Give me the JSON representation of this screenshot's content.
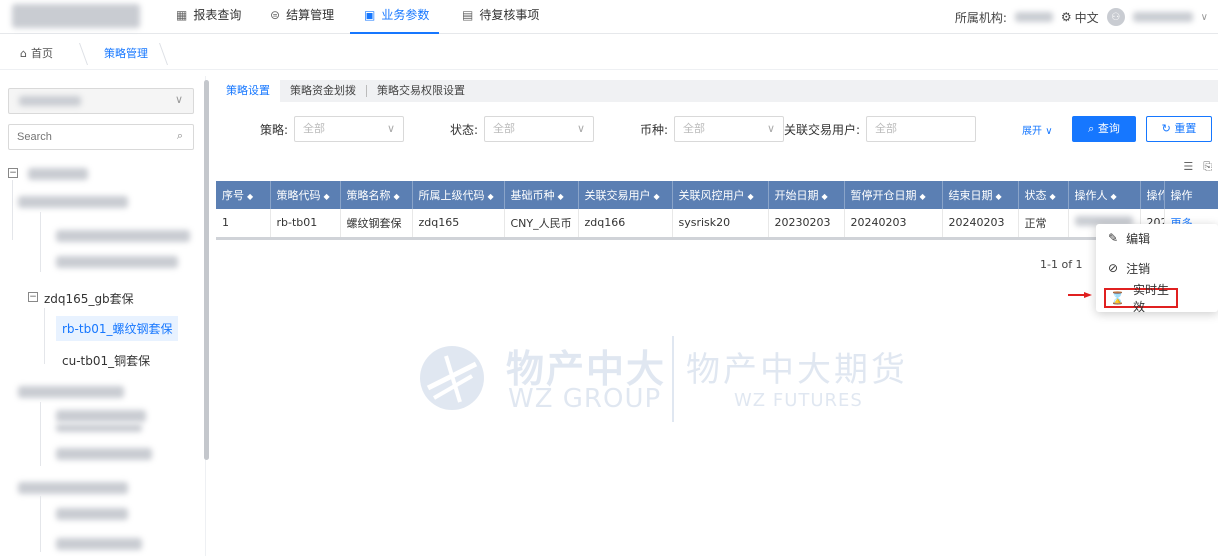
{
  "nav": {
    "items": [
      {
        "icon": "table-icon",
        "glyph": "▦",
        "label": "报表查询"
      },
      {
        "icon": "settlement-icon",
        "glyph": "⊜",
        "label": "结算管理"
      },
      {
        "icon": "params-icon",
        "glyph": "▣",
        "label": "业务参数"
      },
      {
        "icon": "review-icon",
        "glyph": "▤",
        "label": "待复核事项"
      }
    ],
    "org_label": "所属机构:",
    "lang": "中文",
    "lang_icon": "⚙"
  },
  "breadcrumb": {
    "home": "首页",
    "current": "策略管理"
  },
  "sidebar": {
    "search_placeholder": "Search",
    "group_label": "zdq165_gb套保",
    "selected_node": "rb-tb01_螺纹钢套保",
    "other_node": "cu-tb01_铜套保"
  },
  "tabs": [
    "策略设置",
    "策略资金划拨",
    "策略交易权限设置"
  ],
  "filters": {
    "strategy_label": "策略:",
    "strategy_value": "全部",
    "status_label": "状态:",
    "status_value": "全部",
    "currency_label": "币种:",
    "currency_value": "全部",
    "user_label": "关联交易用户:",
    "user_placeholder": "全部",
    "expand": "展开",
    "query": "查询",
    "reset": "重置"
  },
  "table": {
    "headers": [
      "序号",
      "策略代码",
      "策略名称",
      "所属上级代码",
      "基础币种",
      "关联交易用户",
      "关联风控用户",
      "开始日期",
      "暂停开仓日期",
      "结束日期",
      "状态",
      "操作人",
      "操作",
      "操作"
    ],
    "rows": [
      [
        "1",
        "rb-tb01",
        "螺纹钢套保",
        "zdq165",
        "CNY_人民币",
        "zdq166",
        "sysrisk20",
        "20230203",
        "20240203",
        "20240203",
        "正常",
        "",
        "202",
        "更多"
      ]
    ]
  },
  "pagination": "1-1 of 1",
  "watermark": {
    "cn": "物产中大",
    "en": "WZ GROUP",
    "cn2": "物产中大期货",
    "en2": "WZ FUTURES"
  },
  "context_menu": {
    "edit": "编辑",
    "cancel": "注销",
    "realtime": "实时生效"
  },
  "colors": {
    "accent": "#1677ff",
    "table_header": "#5b7fb3",
    "highlight": "#e02020"
  }
}
